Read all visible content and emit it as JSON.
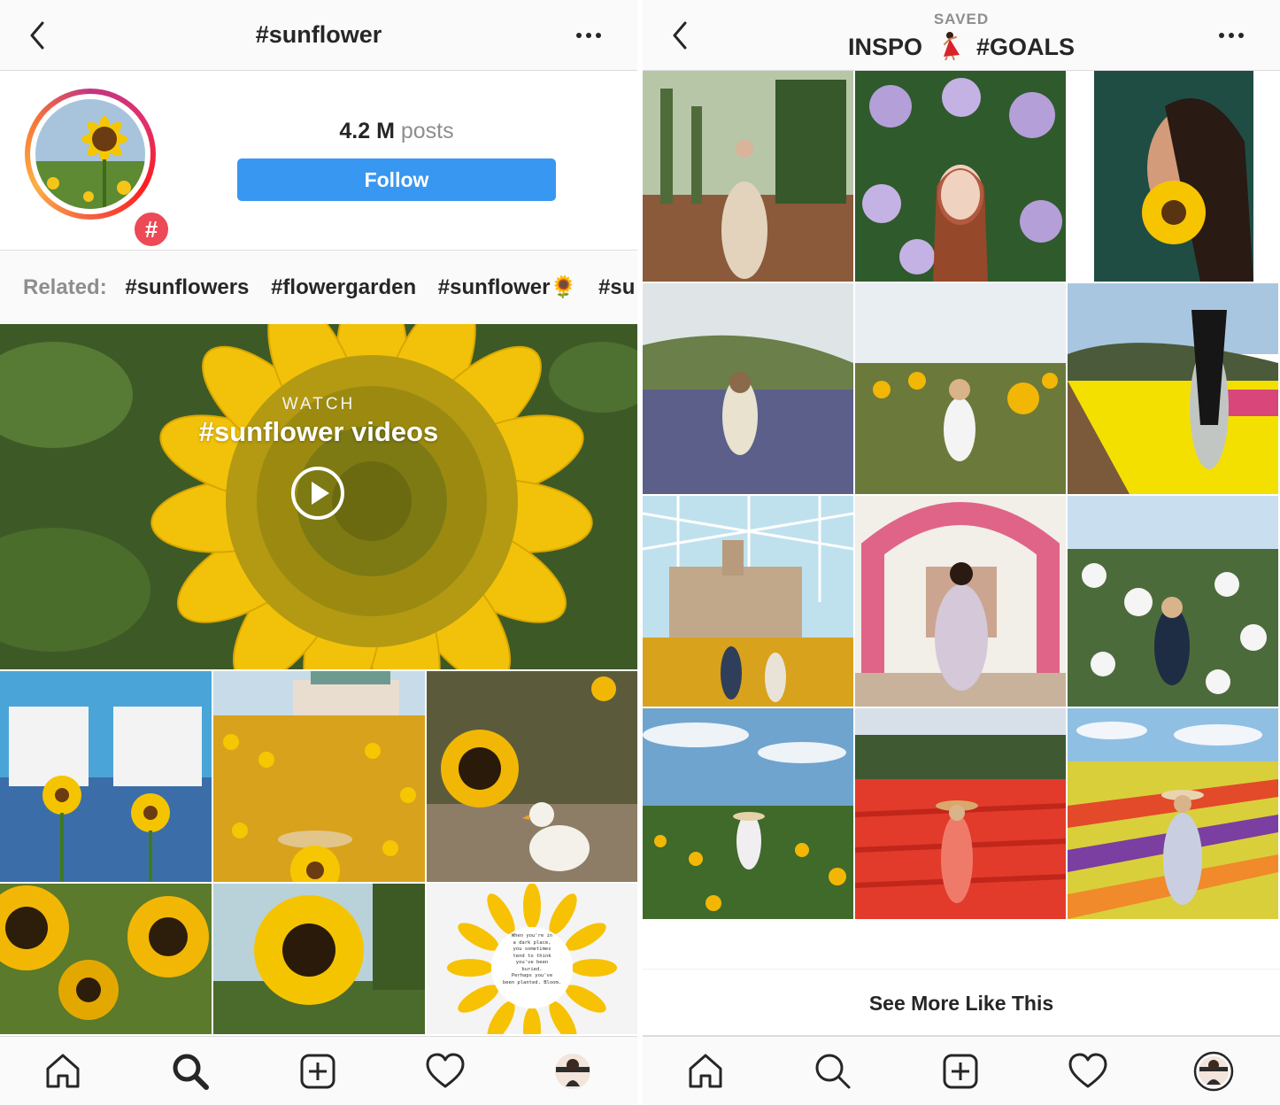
{
  "left_screen": {
    "header": {
      "title": "#sunflower"
    },
    "profile": {
      "post_count": "4.2 M",
      "post_label": "posts",
      "follow_label": "Follow",
      "badge": "#"
    },
    "related": {
      "label": "Related:",
      "tags": [
        "#sunflowers",
        "#flowergarden",
        "#sunflower🌻",
        "#su"
      ]
    },
    "video": {
      "watch_label": "WATCH",
      "title": "#sunflower videos"
    },
    "grid": [
      {
        "name": "two-women-holding-sunflowers"
      },
      {
        "name": "sunflower-field-hat"
      },
      {
        "name": "sunflower-and-duck"
      },
      {
        "name": "sunflowers-closeup"
      },
      {
        "name": "single-sunflower"
      },
      {
        "name": "sunflower-petals-quote",
        "quote_lines": [
          "When you're in",
          "a dark place,",
          "you sometimes",
          "tend to think",
          "you've been",
          "buried.",
          "Perhaps you've",
          "been planted. Bloom."
        ]
      }
    ]
  },
  "right_screen": {
    "header": {
      "subtitle": "SAVED",
      "title_left": "INSPO",
      "title_right": "#GOALS"
    },
    "grid": [
      {
        "name": "cactus-garden-woman"
      },
      {
        "name": "lilac-portrait"
      },
      {
        "name": "sunflower-face"
      },
      {
        "name": "lupine-field"
      },
      {
        "name": "sunflower-field-woman"
      },
      {
        "name": "tulip-field-long-hair"
      },
      {
        "name": "glass-dome-castle"
      },
      {
        "name": "flower-arch-house"
      },
      {
        "name": "white-rose-bush"
      },
      {
        "name": "sunflower-field-sky"
      },
      {
        "name": "red-flower-field"
      },
      {
        "name": "striped-flower-hills"
      }
    ],
    "see_more": "See More Like This"
  },
  "tabbar": {
    "items": [
      "home-icon",
      "search-icon",
      "new-post-icon",
      "activity-icon",
      "profile-icon"
    ]
  },
  "colors": {
    "accent": "#3897f0",
    "badge": "#ed4956",
    "text": "#262626",
    "muted": "#8e8e8e"
  }
}
